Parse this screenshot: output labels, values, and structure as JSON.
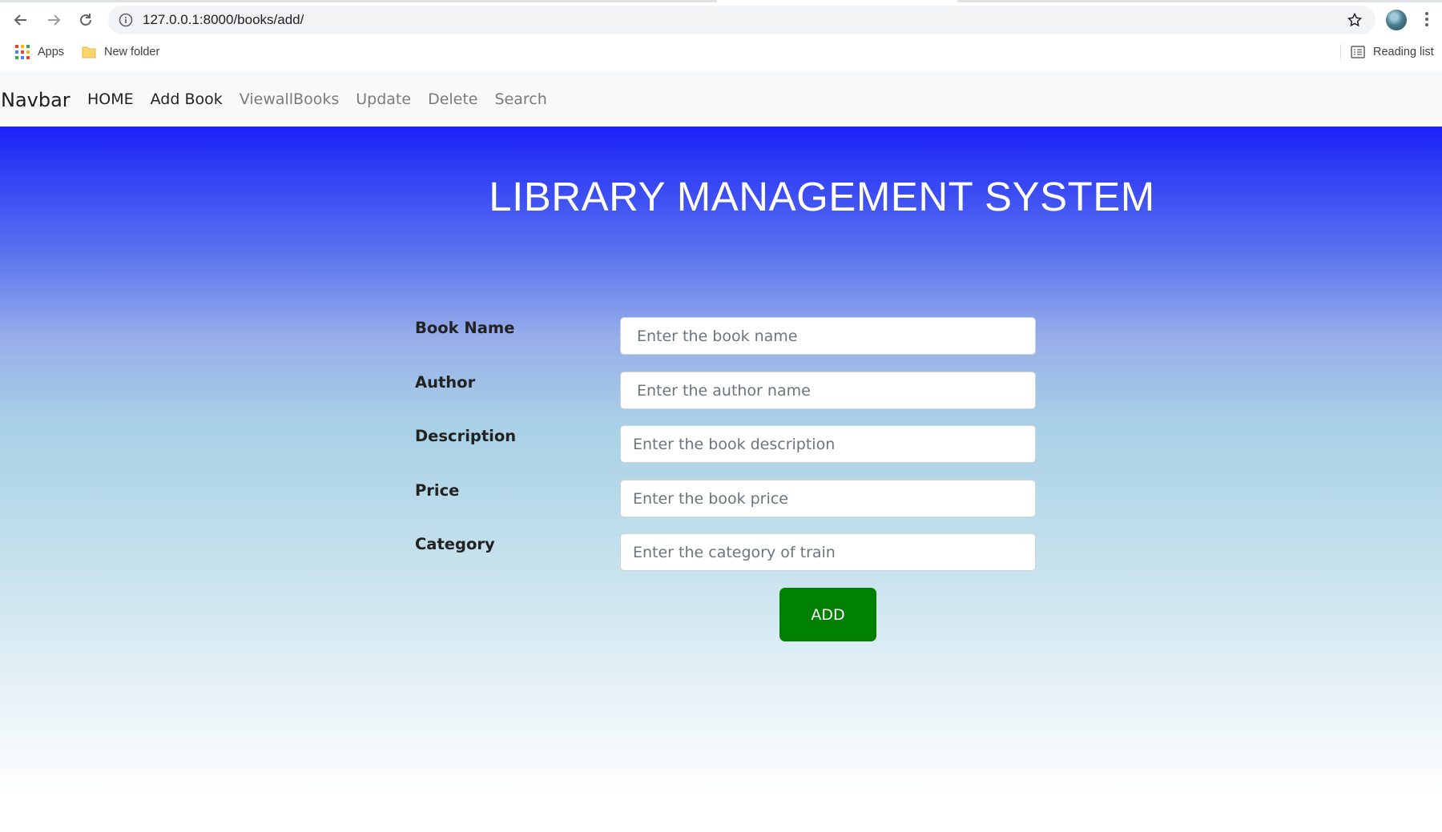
{
  "browser": {
    "url": "127.0.0.1:8000/books/add/",
    "bookmarks": [
      {
        "label": "Apps",
        "icon": "apps-grid-icon"
      },
      {
        "label": "New folder",
        "icon": "folder-icon"
      }
    ],
    "reading_list_label": "Reading list",
    "icons": [
      "back-arrow-icon",
      "forward-arrow-icon",
      "reload-icon",
      "info-icon",
      "star-icon",
      "profile-avatar",
      "more-menu-icon"
    ]
  },
  "navbar": {
    "brand": "Navbar",
    "links": [
      "HOME",
      "Add Book",
      "ViewallBooks",
      "Update",
      "Delete",
      "Search"
    ]
  },
  "page": {
    "title": "LIBRARY MANAGEMENT SYSTEM",
    "form": {
      "fields": [
        {
          "label": "Book Name",
          "placeholder": "Enter the book name",
          "value": ""
        },
        {
          "label": "Author",
          "placeholder": "Enter the author name",
          "value": ""
        },
        {
          "label": "Description",
          "placeholder": "Enter the book description",
          "value": ""
        },
        {
          "label": "Price",
          "placeholder": "Enter the book price",
          "value": ""
        },
        {
          "label": "Category",
          "placeholder": "Enter the category of train",
          "value": ""
        }
      ],
      "submit_label": "ADD"
    }
  },
  "colors": {
    "hero_top": "#1a22f7",
    "hero_bottom": "#ffffff",
    "add_button": "#008000",
    "navbar_bg": "#f8f9fa"
  }
}
